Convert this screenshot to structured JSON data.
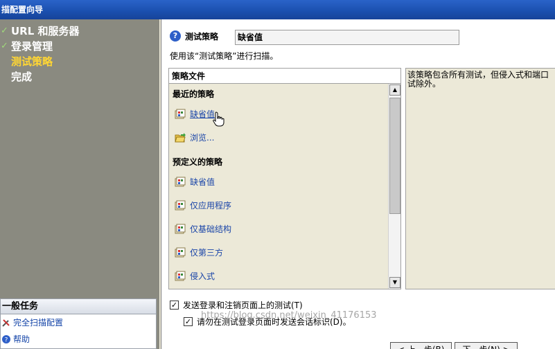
{
  "window": {
    "title": "描配置向导"
  },
  "steps": [
    {
      "label": "URL 和服务器",
      "done": true
    },
    {
      "label": "登录管理",
      "done": true
    },
    {
      "label": "测试策略",
      "current": true
    },
    {
      "label": "完成"
    }
  ],
  "tasks": {
    "title": "一般任务",
    "items": [
      {
        "label": "完全扫描配置",
        "icon": "tools-icon"
      },
      {
        "label": "帮助",
        "icon": "help-icon"
      }
    ]
  },
  "policy": {
    "label": "测试策略",
    "value": "缺省值",
    "description": "使用该“测试策略”进行扫描。"
  },
  "policy_file": {
    "header": "策略文件",
    "recent_title": "最近的策略",
    "recent": [
      {
        "label": "缺省值"
      },
      {
        "label": "浏览..."
      }
    ],
    "predefined_title": "预定义的策略",
    "predefined": [
      {
        "label": "缺省值"
      },
      {
        "label": "仅应用程序"
      },
      {
        "label": "仅基础结构"
      },
      {
        "label": "仅第三方"
      },
      {
        "label": "侵入式"
      }
    ]
  },
  "policy_detail": "该策略包含所有测试，但侵入式和端口试除外。",
  "options": {
    "send_login": "发送登录和注销页面上的测试(T)",
    "no_session": "请勿在测试登录页面时发送会话标识(D)。"
  },
  "buttons": {
    "back": "< 上一步(B)",
    "next": "下一步(N) >"
  },
  "watermark": "https://blog.csdn.net/weixin_41176153"
}
